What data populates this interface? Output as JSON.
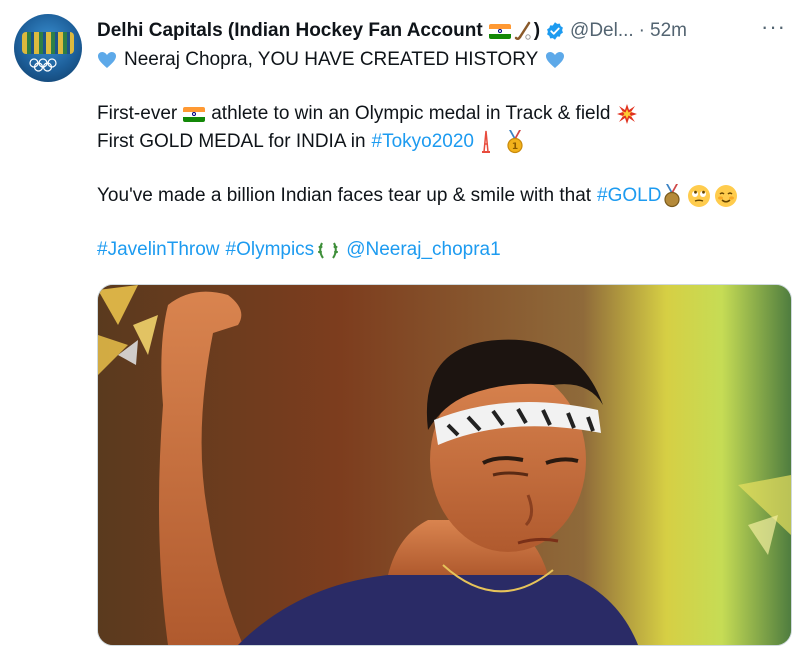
{
  "tweet": {
    "display_name": "Delhi Capitals (Indian Hockey Fan Account",
    "name_suffix": ")",
    "handle": "@Del...",
    "dot": "·",
    "time": "52m",
    "more_label": "···",
    "line1_text": "Neeraj Chopra, YOU HAVE CREATED HISTORY",
    "line2_prefix": "First-ever",
    "line2_rest": "athlete to win an Olympic medal in Track & field",
    "line3_text": "First GOLD MEDAL for INDIA in",
    "line3_hashtag": "#Tokyo2020",
    "line4_text": "You've made a billion Indian faces tear up & smile with that",
    "line4_hashtag": "#GOLD",
    "tag1": "#JavelinThrow",
    "tag2": "#Olympics",
    "mention": "@Neeraj_chopra1"
  },
  "colors": {
    "link": "#1d9bf0",
    "heart": "#5da9e9",
    "verified": "#1d9bf0",
    "secondary_text": "#536471"
  },
  "icons": [
    "blue-heart-icon",
    "india-flag-icon",
    "hockey-icon",
    "verified-badge-icon",
    "collision-icon",
    "tokyo-tower-icon",
    "gold-medal-icon",
    "eye-roll-face-icon",
    "smiling-face-icon",
    "laurel-icon"
  ]
}
